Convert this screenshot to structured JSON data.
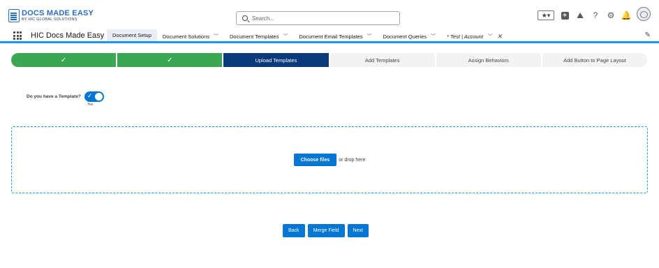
{
  "header": {
    "logo_main": "DOCS MADE EASY",
    "logo_sub": "BY HIC GLOBAL SOLUTIONS",
    "search_placeholder": "Search...",
    "icons": [
      "favorites-star-icon",
      "add-icon",
      "trailhead-icon",
      "help-icon",
      "setup-gear-icon",
      "notification-bell-icon",
      "avatar"
    ]
  },
  "navbar": {
    "app_name": "HIC Docs Made Easy",
    "items": [
      {
        "label": "Document Setup",
        "active": true
      },
      {
        "label": "Document Solutions"
      },
      {
        "label": "Document Templates"
      },
      {
        "label": "Document Email Templates"
      },
      {
        "label": "Document Queries"
      },
      {
        "label": "* Test | Account"
      }
    ]
  },
  "path": {
    "steps": [
      {
        "label": "",
        "state": "done"
      },
      {
        "label": "",
        "state": "done"
      },
      {
        "label": "Upload Templates",
        "state": "current"
      },
      {
        "label": "Add Templates",
        "state": "todo"
      },
      {
        "label": "Assign Behaviors",
        "state": "todo"
      },
      {
        "label": "Add Button to Page Layout",
        "state": "todo"
      }
    ]
  },
  "template_toggle": {
    "label": "Do you have a Template?",
    "state_text": "Yes",
    "checked": true
  },
  "upload": {
    "button_label": "Choose files",
    "drop_text": "or drop here"
  },
  "actions": {
    "back": "Back",
    "merge_field": "Merge Field",
    "next": "Next"
  },
  "colors": {
    "brand_blue": "#0176d3",
    "done_green": "#3ba755",
    "current_navy": "#0b3a7a",
    "nav_accent": "#1b96ff"
  }
}
